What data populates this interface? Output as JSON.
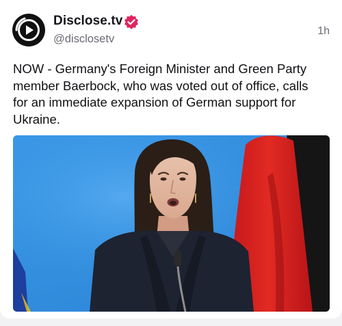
{
  "post": {
    "author_name": "Disclose.tv",
    "author_handle": "@disclosetv",
    "timestamp": "1h",
    "verified": true,
    "verified_badge_color": "#e0245e",
    "avatar_icon": "disclose-play-logo-icon",
    "text": "NOW - Germany's Foreign Minister and Green Party\nmember Baerbock, who was voted out of office, calls\nfor an immediate expansion of German support for\nUkraine.",
    "media": {
      "kind": "image",
      "background_color": "#2f8ee0"
    }
  }
}
